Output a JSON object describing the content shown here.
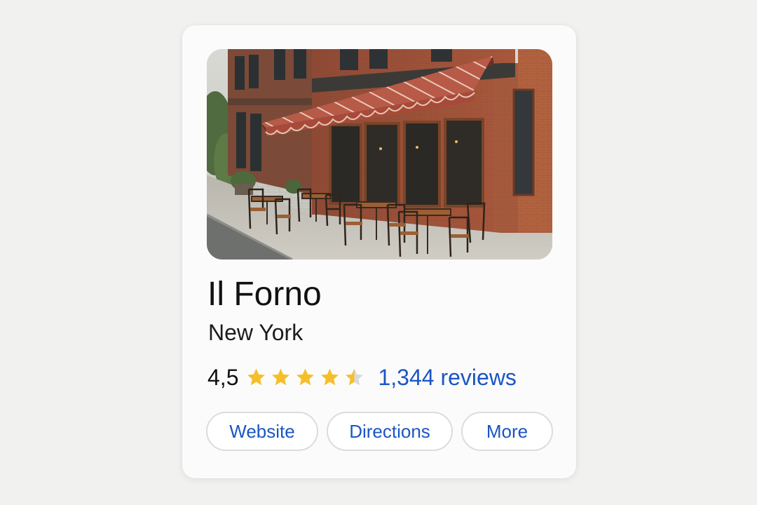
{
  "place": {
    "name": "Il Forno",
    "location": "New York",
    "rating": "4,5",
    "rating_value": 4.5,
    "reviews_label": "1,344 reviews",
    "photo_alt": "Il Forno"
  },
  "actions": {
    "website": "Website",
    "directions": "Directions",
    "more": "More"
  },
  "colors": {
    "star_filled": "#f5bf2a",
    "star_empty": "#d9d9d9",
    "link_blue": "#1a56c4",
    "card_bg": "#fbfbfb",
    "page_bg": "#f1f1f0"
  },
  "icons": {
    "rating": "star-icon"
  }
}
